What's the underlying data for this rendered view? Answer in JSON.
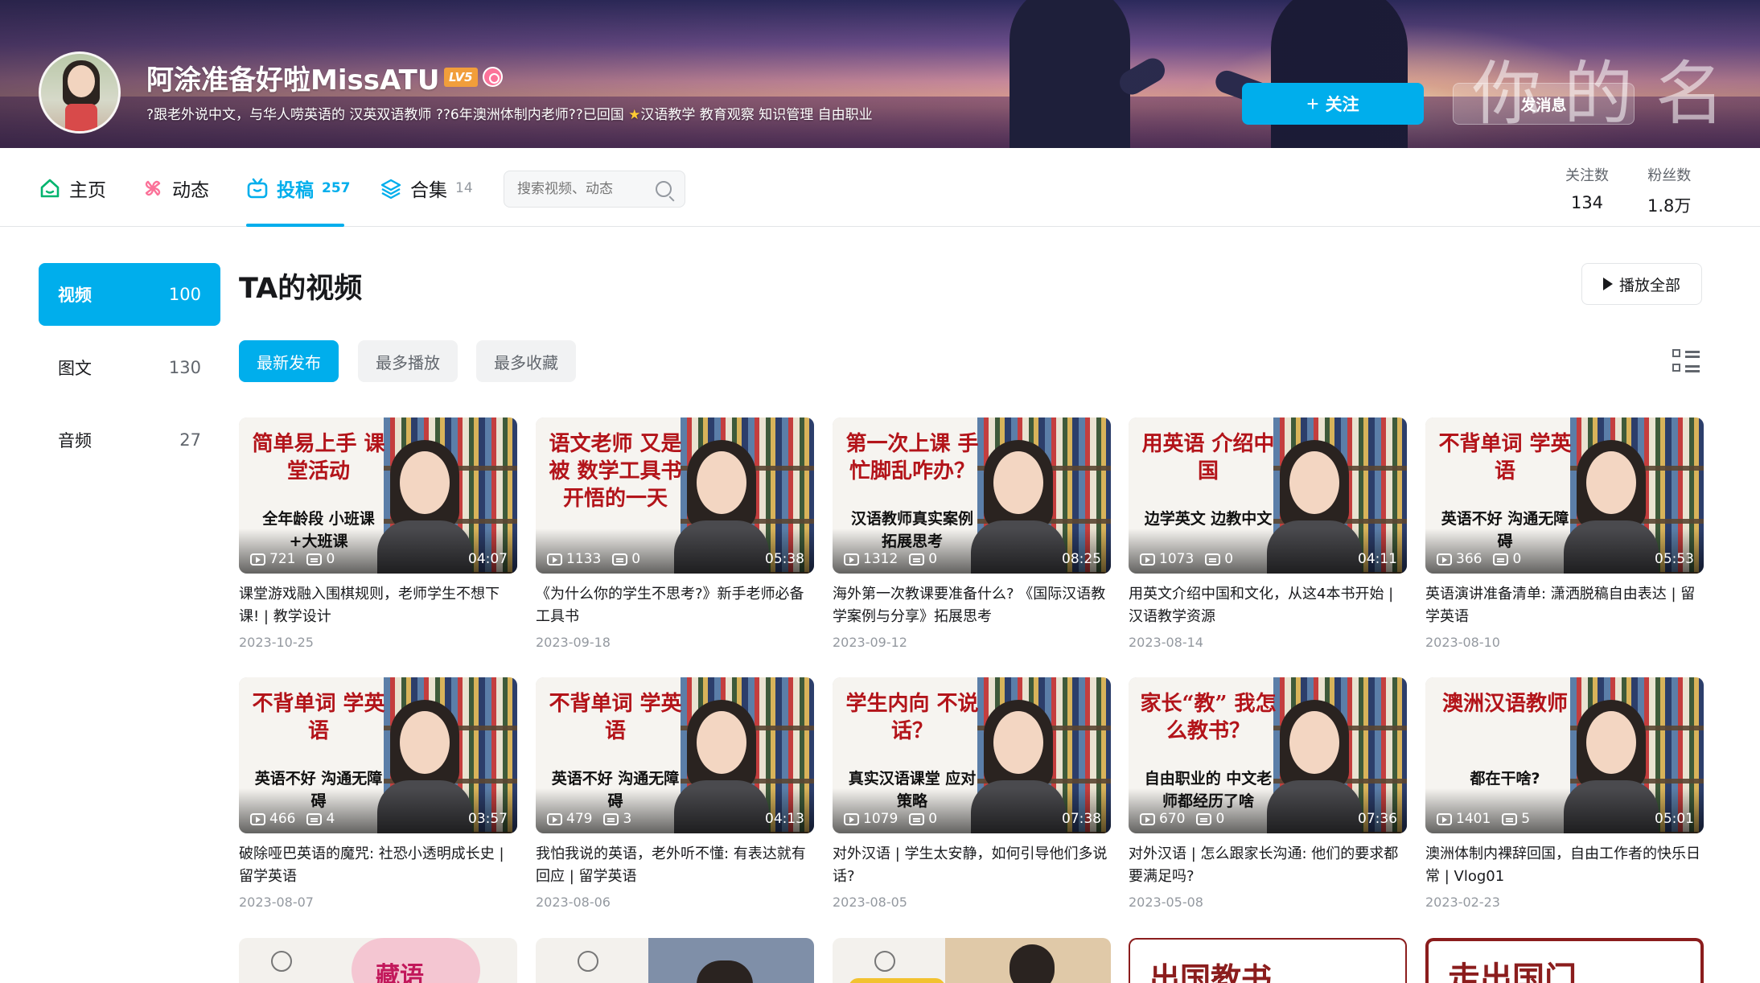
{
  "banner": {
    "watermark_text": "你的名"
  },
  "profile": {
    "name": "阿涂准备好啦MissATU",
    "level": "LV5",
    "sign_before_star": "?跟老外说中文，与华人唠英语的 汉英双语教师 ??6年澳洲体制内老师??已回国 ",
    "sign_after_star": "汉语教学 教育观察 知识管理 自由职业",
    "follow_label": "关注",
    "message_label": "发消息"
  },
  "nav": {
    "tabs": [
      {
        "label": "主页",
        "count": ""
      },
      {
        "label": "动态",
        "count": ""
      },
      {
        "label": "投稿",
        "count": "257"
      },
      {
        "label": "合集",
        "count": "14"
      }
    ],
    "search_placeholder": "搜索视频、动态",
    "stats": [
      {
        "label": "关注数",
        "value": "134"
      },
      {
        "label": "粉丝数",
        "value": "1.8万"
      }
    ]
  },
  "sidebar": {
    "items": [
      {
        "label": "视频",
        "count": "100"
      },
      {
        "label": "图文",
        "count": "130"
      },
      {
        "label": "音频",
        "count": "27"
      }
    ]
  },
  "main": {
    "title": "TA的视频",
    "play_all": "播放全部",
    "sort": [
      "最新发布",
      "最多播放",
      "最多收藏"
    ],
    "videos": [
      {
        "overlay1": "简单易上手 课堂活动",
        "overlay2": "全年龄段 小班课+大班课",
        "plays": "721",
        "danmaku": "0",
        "duration": "04:07",
        "title": "课堂游戏融入围棋规则，老师学生不想下课! | 教学设计",
        "date": "2023-10-25"
      },
      {
        "overlay1": "语文老师 又是被 数学工具书 开悟的一天",
        "overlay2": "",
        "plays": "1133",
        "danmaku": "0",
        "duration": "05:38",
        "title": "《为什么你的学生不思考?》新手老师必备工具书",
        "date": "2023-09-18"
      },
      {
        "overlay1": "第一次上课 手忙脚乱咋办？",
        "overlay2": "汉语教师真实案例 拓展思考",
        "plays": "1312",
        "danmaku": "0",
        "duration": "08:25",
        "title": "海外第一次教课要准备什么? 《国际汉语教学案例与分享》拓展思考",
        "date": "2023-09-12"
      },
      {
        "overlay1": "用英语 介绍中国",
        "overlay2": "边学英文 边教中文",
        "plays": "1073",
        "danmaku": "0",
        "duration": "04:11",
        "title": "用英文介绍中国和文化，从这4本书开始 | 汉语教学资源",
        "date": "2023-08-14"
      },
      {
        "overlay1": "不背单词 学英语",
        "overlay2": "英语不好 沟通无障碍",
        "plays": "366",
        "danmaku": "0",
        "duration": "05:53",
        "title": "英语演讲准备清单: 潇洒脱稿自由表达 | 留学英语",
        "date": "2023-08-10"
      },
      {
        "overlay1": "不背单词 学英语",
        "overlay2": "英语不好 沟通无障碍",
        "plays": "466",
        "danmaku": "4",
        "duration": "03:57",
        "title": "破除哑巴英语的魔咒: 社恐小透明成长史 | 留学英语",
        "date": "2023-08-07"
      },
      {
        "overlay1": "不背单词 学英语",
        "overlay2": "英语不好 沟通无障碍",
        "plays": "479",
        "danmaku": "3",
        "duration": "04:13",
        "title": "我怕我说的英语，老外听不懂: 有表达就有回应 | 留学英语",
        "date": "2023-08-06"
      },
      {
        "overlay1": "学生内向 不说话？",
        "overlay2": "真实汉语课堂 应对策略",
        "plays": "1079",
        "danmaku": "0",
        "duration": "07:38",
        "title": "对外汉语 | 学生太安静，如何引导他们多说话?",
        "date": "2023-08-05"
      },
      {
        "overlay1": "家长“教” 我怎么教书？",
        "overlay2": "自由职业的 中文老师都经历了啥",
        "plays": "670",
        "danmaku": "0",
        "duration": "07:36",
        "title": "对外汉语 | 怎么跟家长沟通: 他们的要求都要满足吗?",
        "date": "2023-05-08"
      },
      {
        "overlay1": "澳洲汉语教师",
        "overlay2": "都在干啥?",
        "plays": "1401",
        "danmaku": "5",
        "duration": "05:01",
        "title": "澳洲体制内裸辞回国，自由工作者的快乐日常 | Vlog01",
        "date": "2023-02-23"
      }
    ],
    "peek_texts": [
      "藏语",
      "",
      "",
      "出国教书",
      "走出国门"
    ]
  },
  "colors": {
    "accent": "#00aeec",
    "text": "#18191c",
    "muted": "#9499a0",
    "brand_red": "#b3141a"
  }
}
